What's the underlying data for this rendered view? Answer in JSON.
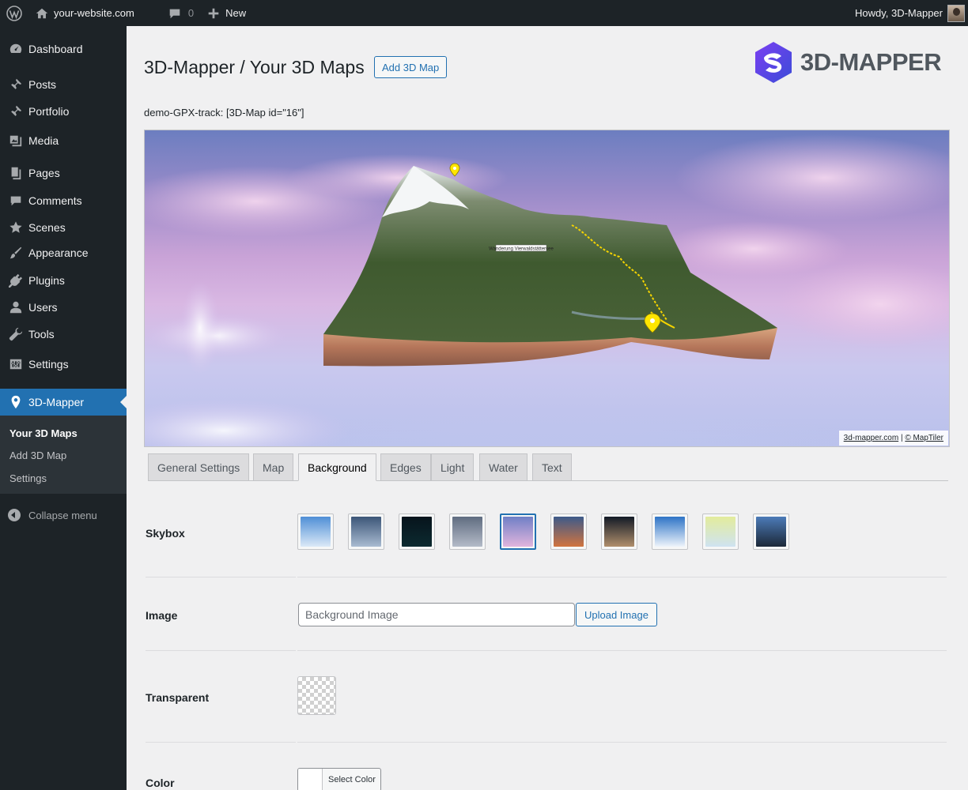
{
  "admin_bar": {
    "site_name": "your-website.com",
    "comments_count": "0",
    "new_label": "New",
    "greeting": "Howdy, 3D-Mapper"
  },
  "sidebar": {
    "items": [
      {
        "label": "Dashboard",
        "icon": "dashboard-icon"
      },
      {
        "label": "Posts",
        "icon": "pin-icon"
      },
      {
        "label": "Portfolio",
        "icon": "pin-icon"
      },
      {
        "label": "Media",
        "icon": "media-icon"
      },
      {
        "label": "Pages",
        "icon": "pages-icon"
      },
      {
        "label": "Comments",
        "icon": "comment-icon"
      },
      {
        "label": "Scenes",
        "icon": "star-icon"
      },
      {
        "label": "Appearance",
        "icon": "brush-icon"
      },
      {
        "label": "Plugins",
        "icon": "plug-icon"
      },
      {
        "label": "Users",
        "icon": "user-icon"
      },
      {
        "label": "Tools",
        "icon": "wrench-icon"
      },
      {
        "label": "Settings",
        "icon": "sliders-icon"
      },
      {
        "label": "3D-Mapper",
        "icon": "location-pin-icon"
      }
    ],
    "submenu": [
      "Your 3D Maps",
      "Add 3D Map",
      "Settings"
    ],
    "collapse_label": "Collapse menu"
  },
  "page": {
    "title": "3D-Mapper / Your 3D Maps",
    "add_button": "Add 3D Map",
    "logo_text": "3D-MAPPER",
    "shortcode": "demo-GPX-track: [3D-Map id=\"16\"]"
  },
  "map": {
    "attribution_site": "3d-mapper.com",
    "attribution_separator": "|",
    "attribution_tiles": "© MapTiler",
    "label_on_map": "Wanderung Vierwaldstättersee"
  },
  "tabs": [
    "General Settings",
    "Map",
    "Background",
    "Edges",
    "Light",
    "Water",
    "Text"
  ],
  "active_tab": "Background",
  "form": {
    "skybox_label": "Skybox",
    "image_label": "Image",
    "image_placeholder": "Background Image",
    "upload_button": "Upload Image",
    "transparent_label": "Transparent",
    "color_label": "Color",
    "color_button": "Select Color"
  },
  "skyboxes": [
    {
      "name": "skybox-blue-clouds",
      "top": "#4f8fd6",
      "bottom": "#dbe9f7"
    },
    {
      "name": "skybox-overcast",
      "top": "#3c5678",
      "bottom": "#a9bbd1"
    },
    {
      "name": "skybox-night-stars",
      "top": "#07141c",
      "bottom": "#0c2a30"
    },
    {
      "name": "skybox-grey-clouds",
      "top": "#5f6c80",
      "bottom": "#b4bbc8"
    },
    {
      "name": "skybox-pink-dusk",
      "top": "#6f7fc6",
      "bottom": "#e2b5dd"
    },
    {
      "name": "skybox-sunset",
      "top": "#3d5a8a",
      "bottom": "#d1743f"
    },
    {
      "name": "skybox-dark-storm",
      "top": "#121a26",
      "bottom": "#b08f6c"
    },
    {
      "name": "skybox-clear-day",
      "top": "#2e74c6",
      "bottom": "#eef4fb"
    },
    {
      "name": "skybox-pale-yellow",
      "top": "#e3ec9c",
      "bottom": "#cfe3f1"
    },
    {
      "name": "skybox-deep-blue",
      "top": "#4c7bb8",
      "bottom": "#1c2838"
    }
  ],
  "selected_skybox": "skybox-pink-dusk",
  "colors": {
    "accent": "#2271b1",
    "admin_bg": "#1d2327",
    "logo_purple": "#5b3fd1"
  }
}
